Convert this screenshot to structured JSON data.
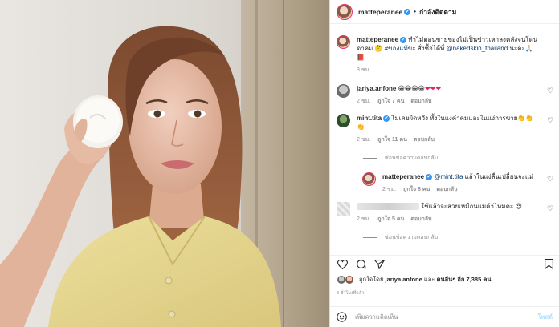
{
  "header": {
    "username": "matteperanee",
    "verified_glyph": "✔",
    "separator": "•",
    "follow_status": "กำลังติดตาม"
  },
  "caption": {
    "username": "matteperanee",
    "text": "ทำไม่ตอนขายของไม่เป็นข่าวเหาลงคลังจนโดนด่าคม 🤔",
    "hashtag": "#ของแท้ขะ",
    "text2": " สั่งซื้อได้ที่ ",
    "mention": "@nakedskin_thailand",
    "text3": " นะคะ🙏🏻📕",
    "time": "3 ชม."
  },
  "comments": [
    {
      "username": "jariya.anfone",
      "text": "😁😁😁😁",
      "hearts": "❤❤❤",
      "time": "2 ชม.",
      "likes": "ถูกใจ 7 คน",
      "reply": "ตอบกลับ"
    },
    {
      "username": "mint.tita",
      "text": "ไม่เคยผิดหวัง ทั้งในแง่ค่าคมและในแง่การขาย👏👏👏",
      "time": "2 ชม.",
      "likes": "ถูกใจ 11 คน",
      "reply": "ตอบกลับ"
    }
  ],
  "hide_replies": "ซ่อนข้อความตอบกลับ",
  "nested_reply": {
    "username": "matteperanee",
    "mention": "@mint.tita",
    "text": " แล้วในแง่ลื่นเปลี่ยนจะแม่",
    "time": "2 ชม.",
    "likes": "ถูกใจ 8 คน",
    "reply": "ตอบกลับ"
  },
  "anon_comment": {
    "text": "ใช้แล้วจะสวยเหมือนแม่ค้าไหมคะ 😍",
    "time": "2 ชม.",
    "likes": "ถูกใจ 5 คน",
    "reply": "ตอบกลับ"
  },
  "liked_by": {
    "prefix": "ถูกใจโดย ",
    "user": "jariya.anfone",
    "middle": " และ ",
    "others": "คนอื่นๆ อีก 7,385 คน"
  },
  "posted_ago": "3 ชั่วโมงที่แล้ว",
  "add_comment": {
    "placeholder": "เพิ่มความคิดเห็น",
    "post_label": "โพสต์"
  },
  "colors": {
    "verified": "#3897f0",
    "link": "#00376b",
    "muted": "#8e8e8e",
    "heart": "#e0245e",
    "post_disabled": "#b2dffc"
  }
}
